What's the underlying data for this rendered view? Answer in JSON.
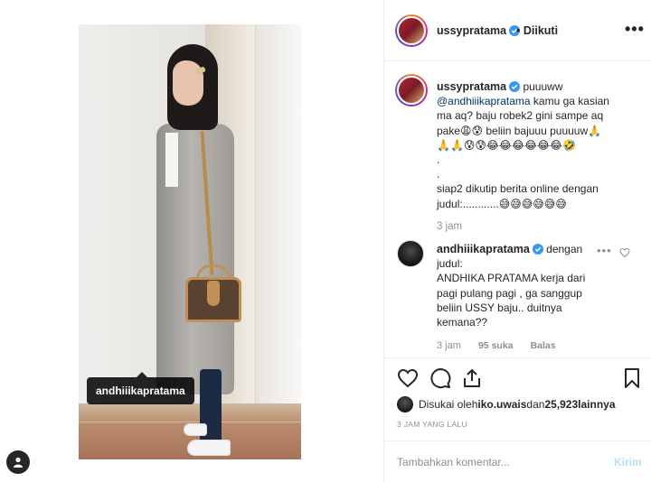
{
  "post": {
    "photo_tag": "andhiiikapratama"
  },
  "header": {
    "username": "ussypratama",
    "follow_status": "• Diikuti",
    "more": "•••"
  },
  "caption": {
    "username": "ussypratama",
    "text_lead": " puuuww",
    "mention": "@andhiiikapratama",
    "text_body": " kamu ga kasian ma aq? baju robek2 gini sampe aq pake😩😰 beliin bajuuu puuuuw🙏\n🙏🙏😰😰😂😂😂😂😂😂🤣\n.\n.\nsiap2 dikutip berita online dengan judul:............😅😅😅😅😅😅",
    "time": "3 jam"
  },
  "comment": {
    "username": "andhiiikapratama",
    "text": " dengan judul:\nANDHIKA PRATAMA kerja dari pagi pulang pagi , ga sanggup beliin USSY baju.. duitnya kemana??",
    "time": "3 jam",
    "likes": "95 suka",
    "reply": "Balas",
    "more": "•••"
  },
  "likes": {
    "prefix": "Disukai oleh ",
    "first_user": "iko.uwais",
    "middle": " dan ",
    "count": "25,923",
    "suffix": " lainnya"
  },
  "timestamp": "3 JAM YANG LALU",
  "add_comment": {
    "placeholder": "Tambahkan komentar...",
    "send_label": "Kirim"
  },
  "colors": {
    "verified": "#3897f0",
    "link": "#003569",
    "send_disabled": "#b2dffc",
    "muted": "#8e8e8e"
  },
  "icons": [
    "heart-icon",
    "comment-icon",
    "share-icon",
    "bookmark-icon",
    "user-tag-icon",
    "verified-icon",
    "more-icon"
  ]
}
